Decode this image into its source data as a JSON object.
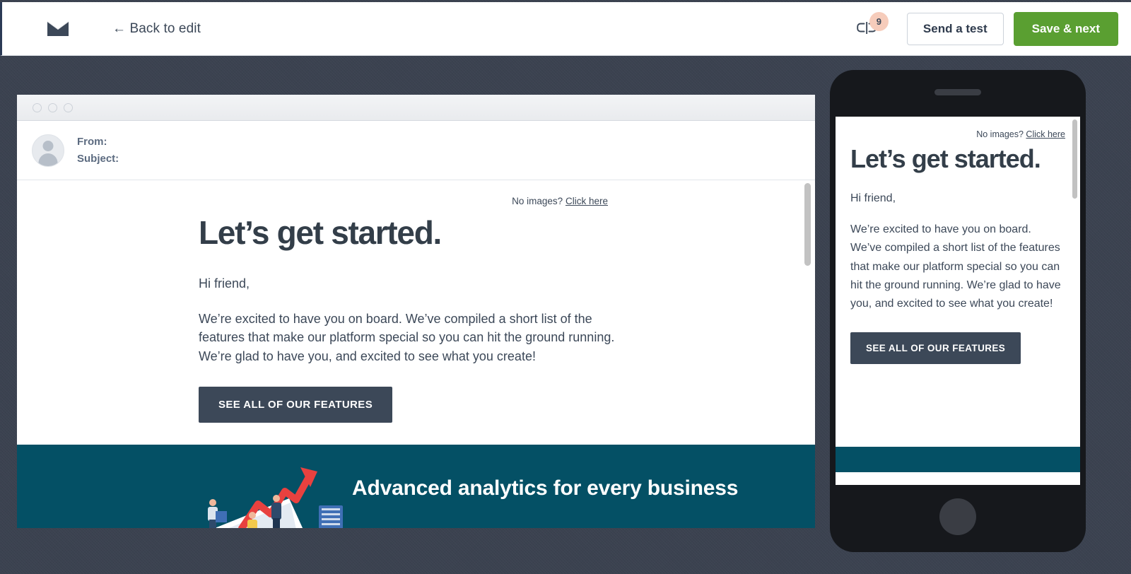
{
  "colors": {
    "page_background": "#3b4250",
    "topbar_background": "#ffffff",
    "topbar_accent_border": "#2b3a55",
    "primary_button": "#5a9f31",
    "badge": "#f6ccbb",
    "email_heading": "#333e49",
    "email_cta": "#3c4858",
    "email_banner_teal": "#045065",
    "phone_body": "#16181c"
  },
  "topbar": {
    "logo_icon": "mail-envelope-icon",
    "back_label": "← Back to edit",
    "comments_icon": "comments-icon",
    "comments_badge": "9",
    "send_test_label": "Send a test",
    "save_next_label": "Save & next"
  },
  "desktop_preview": {
    "window_dots": [
      "dot-1",
      "dot-2",
      "dot-3"
    ],
    "avatar_icon": "user-avatar-icon",
    "from_label": "From:",
    "subject_label": "Subject:",
    "email": {
      "no_images_text": "No images?",
      "no_images_link": "Click here",
      "heading": "Let’s get started.",
      "greeting": "Hi friend,",
      "paragraph": "We’re excited to have you on board. We’ve compiled a short list of the features that make our platform special so you can hit the ground running. We’re glad to have you, and excited to see what you create!",
      "cta_label": "SEE ALL OF OUR FEATURES",
      "banner_heading": "Advanced analytics for every business",
      "banner_illustration": "analytics-growth-arrow-illustration"
    }
  },
  "phone_preview": {
    "speaker_icon": "phone-speaker-icon",
    "home_button_icon": "phone-home-button-icon",
    "email": {
      "no_images_text": "No images?",
      "no_images_link": "Click here",
      "heading": "Let’s get started.",
      "greeting": "Hi friend,",
      "paragraph": "We’re excited to have you on board. We’ve compiled a short list of the features that make our platform special so you can hit the ground running. We’re glad to have you, and excited to see what you create!",
      "cta_label": "SEE ALL OF OUR FEATURES"
    }
  }
}
